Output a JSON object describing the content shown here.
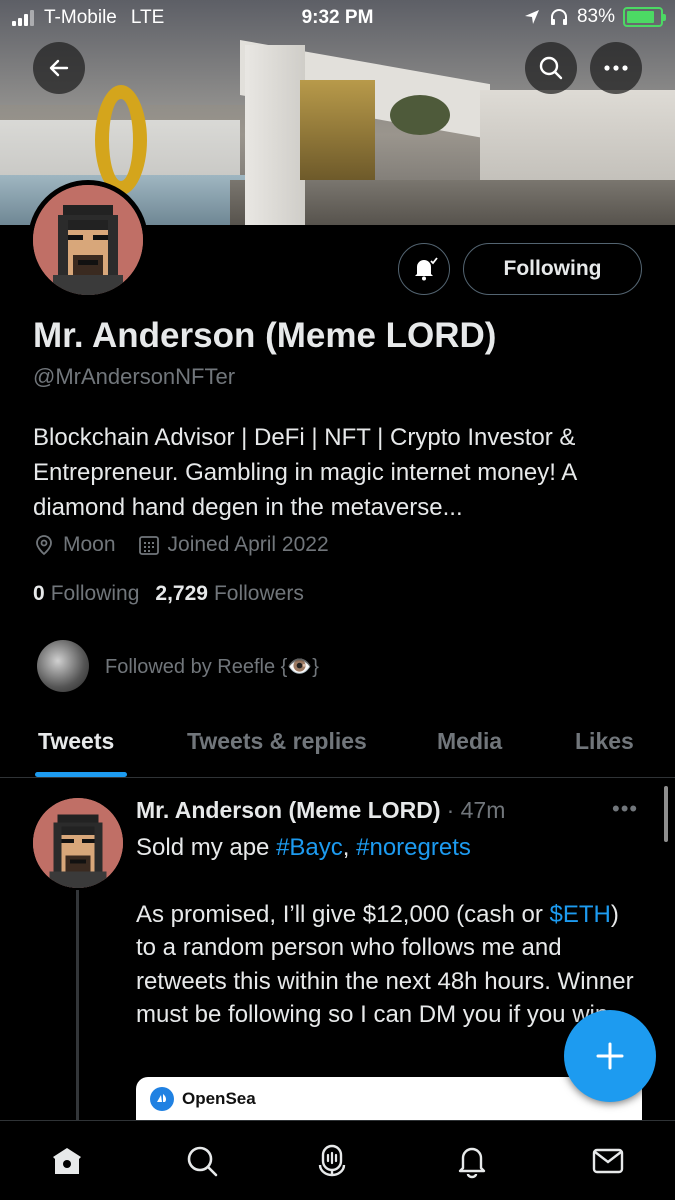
{
  "status_bar": {
    "carrier": "T-Mobile",
    "network": "LTE",
    "time": "9:32 PM",
    "battery_percent": "83%",
    "battery_level": 0.83
  },
  "profile": {
    "name": "Mr. Anderson (Meme LORD)",
    "handle": "@MrAndersonNFTer",
    "bio": "Blockchain Advisor | DeFi | NFT | Crypto Investor & Entrepreneur. Gambling in magic internet money! A diamond hand degen in the metaverse...",
    "location": "Moon",
    "joined": "Joined April 2022",
    "following_count": "0",
    "following_label": "Following",
    "followers_count": "2,729",
    "followers_label": "Followers",
    "followed_by": "Followed by Reefle {👁️}",
    "follow_button_label": "Following"
  },
  "tabs": [
    {
      "label": "Tweets",
      "active": true
    },
    {
      "label": "Tweets & replies",
      "active": false
    },
    {
      "label": "Media",
      "active": false
    },
    {
      "label": "Likes",
      "active": false
    }
  ],
  "tweet": {
    "author": "Mr. Anderson (Meme LORD)",
    "time": "· 47m",
    "more": "•••",
    "line1_text": "Sold my ape ",
    "line1_tag1": "#Bayc",
    "line1_sep": ",  ",
    "line1_tag2": "#noregrets",
    "para_a": "As promised, I’ll give $12,000 (cash or ",
    "para_cashtag": "$ETH",
    "para_b": ") to a random person who follows me and retweets this within the next 48h hours. Winner must be following so I can DM you if you win.",
    "card_brand": "OpenSea"
  },
  "colors": {
    "accent": "#1d9bf0",
    "background": "#000000",
    "text_primary": "#e7e9ea",
    "text_secondary": "#71767b"
  },
  "icons": {
    "back": "arrow-left-icon",
    "search": "search-icon",
    "more": "more-horizontal-icon",
    "notify": "bell-icon",
    "location": "location-pin-icon",
    "calendar": "calendar-icon",
    "compose": "plus-icon",
    "nav": [
      "home-icon",
      "search-icon",
      "spaces-icon",
      "notifications-icon",
      "messages-icon"
    ]
  }
}
